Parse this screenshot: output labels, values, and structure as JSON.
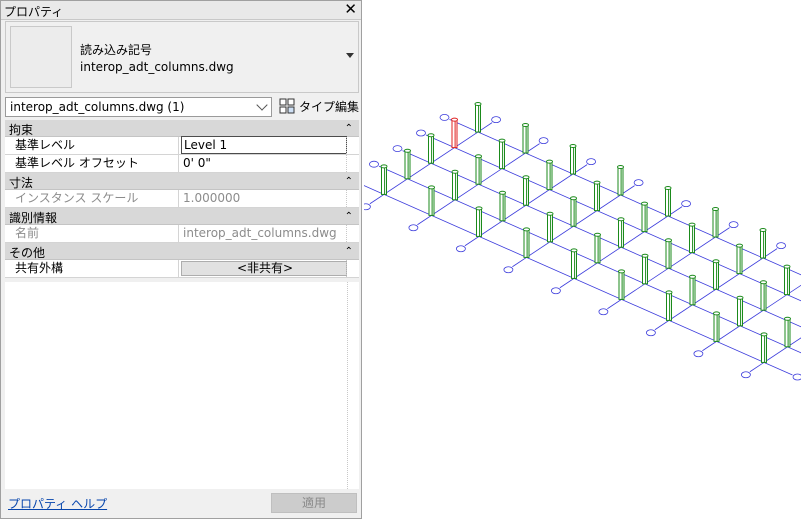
{
  "palette": {
    "title": "プロパティ",
    "close_glyph": "✕",
    "type": {
      "line1": "読み込み記号",
      "line2": "interop_adt_columns.dwg"
    },
    "selector": "interop_adt_columns.dwg (1)",
    "edit_type_label": "タイプ編集",
    "groups": [
      {
        "label": "拘束",
        "rows": [
          {
            "key": "基準レベル",
            "value": "Level 1"
          },
          {
            "key": "基準レベル オフセット",
            "value": "0'  0\""
          }
        ]
      },
      {
        "label": "寸法",
        "rows": [
          {
            "key": "インスタンス スケール",
            "value": "1.000000"
          }
        ]
      },
      {
        "label": "識別情報",
        "rows": [
          {
            "key": "名前",
            "value": "interop_adt_columns.dwg"
          }
        ]
      },
      {
        "label": "その他",
        "rows": [
          {
            "key": "共有外構",
            "value": "<非共有>"
          }
        ]
      }
    ],
    "help_link": "プロパティ ヘルプ",
    "apply_label": "適用"
  },
  "viewport": {
    "grid_color": "#3c3cdc",
    "column_color": "#1b8a1b",
    "selected_column_color": "#e02020",
    "columns_count": 45,
    "selected_columns": 1
  }
}
